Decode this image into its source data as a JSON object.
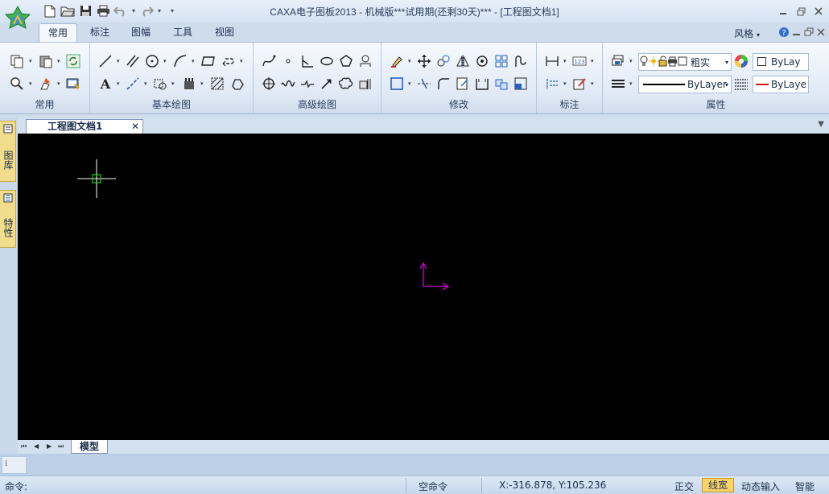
{
  "window": {
    "title": "CAXA电子图板2013 - 机械版***试用期(还剩30天)*** - [工程图文档1]"
  },
  "quick_access": {
    "icons": [
      "new-file-icon",
      "open-folder-icon",
      "save-icon",
      "print-icon",
      "undo-icon",
      "redo-icon",
      "customize-qat-icon"
    ]
  },
  "ribbon": {
    "tabs": [
      {
        "label": "常用",
        "active": true
      },
      {
        "label": "标注"
      },
      {
        "label": "图幅"
      },
      {
        "label": "工具"
      },
      {
        "label": "视图"
      }
    ],
    "style_menu": "风格",
    "groups": {
      "common": "常用",
      "basic_draw": "基本绘图",
      "advanced_draw": "高级绘图",
      "modify": "修改",
      "annotate": "标注",
      "properties": "属性"
    },
    "properties": {
      "layer_name": "粗实",
      "color": "ByLay",
      "linetype": "ByLayer",
      "linecolor": "ByLaye"
    }
  },
  "sidebar": {
    "tabs": [
      "图库",
      "特性"
    ]
  },
  "document": {
    "tab_label": "工程图文档1",
    "close_glyph": "✕",
    "layout_tab": "模型",
    "tab_menu_glyph": "▼"
  },
  "layout_nav": [
    "⏮",
    "◀",
    "▶",
    "⏭"
  ],
  "command_grip": "⁞",
  "status": {
    "command_prompt": "命令:",
    "current_command": "空命令",
    "coordinates": "X:-316.878, Y:105.236",
    "toggles": {
      "ortho": "正交",
      "lineweight": "线宽",
      "dynamic_input": "动态输入",
      "smart": "智能"
    }
  },
  "colors": {
    "canvas": "#000000",
    "cursor": "#ffffff",
    "cursor_box": "#00ff00",
    "ucs": "#d000d0",
    "active_toggle": "#f9d36a"
  }
}
